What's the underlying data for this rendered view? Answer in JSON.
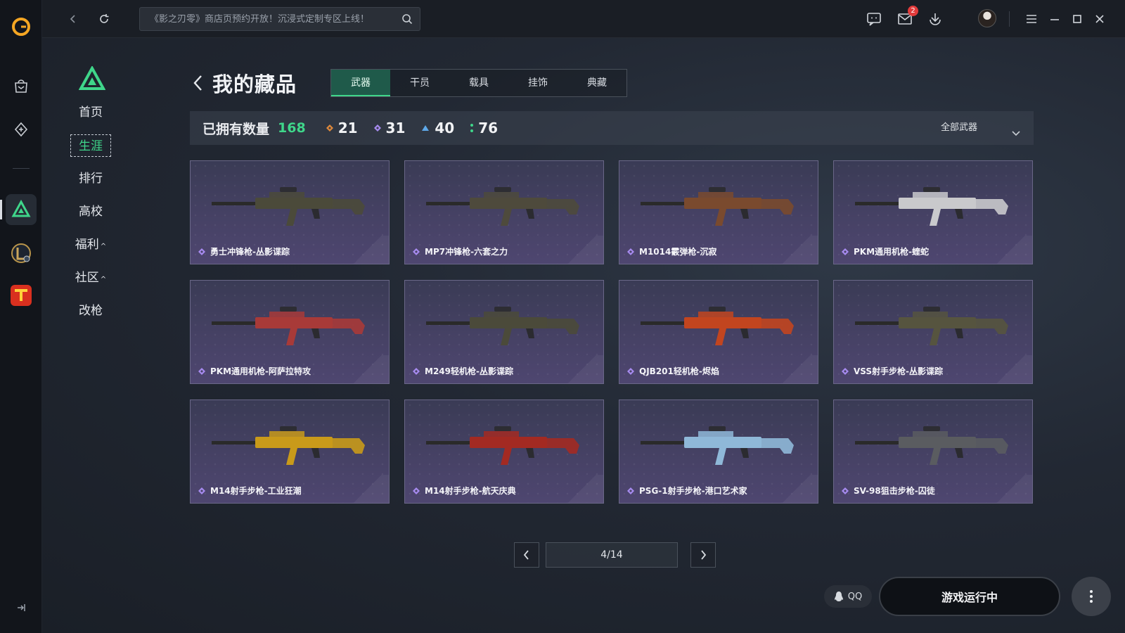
{
  "topbar": {
    "search_placeholder": "《影之刃零》商店页预约开放！沉浸式定制专区上线！",
    "mail_badge": "2"
  },
  "sidenav": {
    "items": [
      {
        "label": "首页"
      },
      {
        "label": "生涯"
      },
      {
        "label": "排行"
      },
      {
        "label": "高校"
      },
      {
        "label": "福利",
        "caret": "^"
      },
      {
        "label": "社区",
        "caret": "^"
      },
      {
        "label": "改枪"
      }
    ],
    "active": "生涯"
  },
  "header": {
    "title": "我的藏品",
    "tabs": [
      {
        "label": "武器"
      },
      {
        "label": "干员"
      },
      {
        "label": "载具"
      },
      {
        "label": "挂饰"
      },
      {
        "label": "典藏"
      }
    ],
    "active_tab": "武器"
  },
  "stats": {
    "owned_label": "已拥有数量",
    "owned_count": "168",
    "counts": [
      {
        "value": "21",
        "color": "#e0893a"
      },
      {
        "value": "31",
        "color": "#a78bf0"
      },
      {
        "value": "40",
        "color": "#5ea8e8"
      },
      {
        "value": "76",
        "color": "#3fd68a"
      }
    ],
    "filter_label": "全部武器"
  },
  "cards": [
    {
      "label": "勇士冲锋枪-丛影谍踪",
      "body_color": "#4b4a3a"
    },
    {
      "label": "MP7冲锋枪-六套之力",
      "body_color": "#4e4a3c"
    },
    {
      "label": "M1014霰弹枪-沉寂",
      "body_color": "#7a4a2e"
    },
    {
      "label": "PKM通用机枪-蝰蛇",
      "body_color": "#c9c9cc"
    },
    {
      "label": "PKM通用机枪-阿萨拉特攻",
      "body_color": "#a83a38"
    },
    {
      "label": "M249轻机枪-丛影谍踪",
      "body_color": "#4b4a3a"
    },
    {
      "label": "QJB201轻机枪-烬焰",
      "body_color": "#c2451f"
    },
    {
      "label": "VSS射手步枪-丛影谍踪",
      "body_color": "#56543f"
    },
    {
      "label": "M14射手步枪-工业狂潮",
      "body_color": "#c99a1a"
    },
    {
      "label": "M14射手步枪-航天庆典",
      "body_color": "#a32a22"
    },
    {
      "label": "PSG-1射手步枪-港口艺术家",
      "body_color": "#8fb8d8"
    },
    {
      "label": "SV-98狙击步枪-囚徒",
      "body_color": "#5a5c60"
    }
  ],
  "pager": {
    "display": "4/14"
  },
  "footer": {
    "qq_label": "QQ",
    "run_label": "游戏运行中"
  },
  "colors": {
    "accent": "#3fd68a",
    "rarity_purple": "#a78bf0"
  }
}
